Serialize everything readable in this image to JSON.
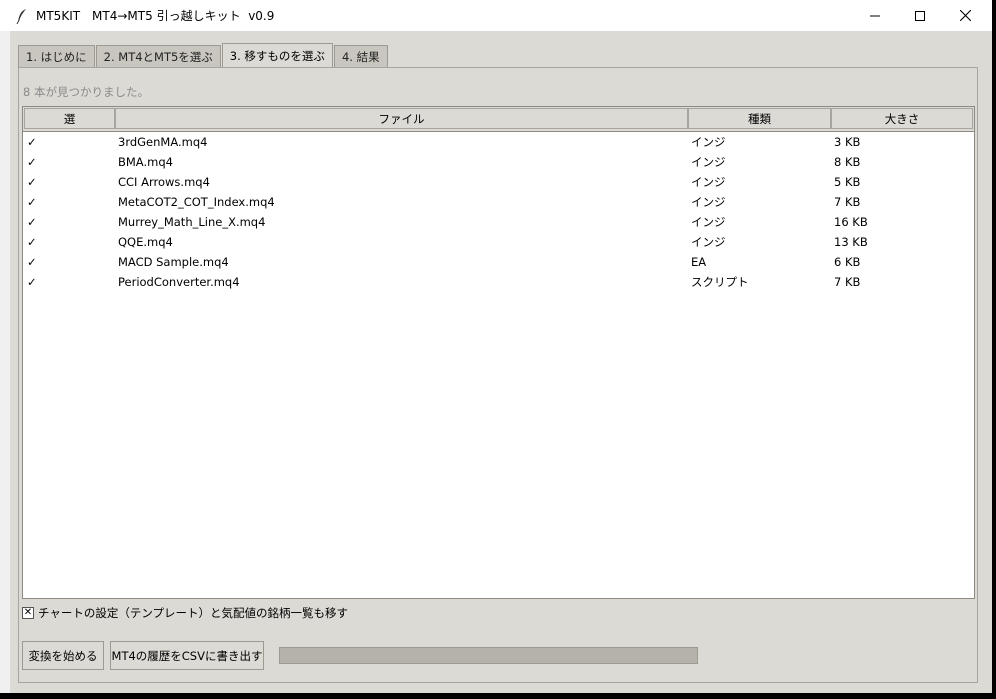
{
  "window": {
    "title": "MT5KIT　MT4→MT5 引っ越しキット  v0.9",
    "icon": "feather-icon"
  },
  "tabs": [
    {
      "label": "1. はじめに",
      "active": false
    },
    {
      "label": "2. MT4とMT5を選ぶ",
      "active": false
    },
    {
      "label": "3. 移すものを選ぶ",
      "active": true
    },
    {
      "label": "4. 結果",
      "active": false
    }
  ],
  "status_text": "8 本が見つかりました。",
  "table": {
    "columns": [
      "選",
      "ファイル",
      "種類",
      "大きさ"
    ],
    "rows": [
      {
        "check": "✓",
        "file": "3rdGenMA.mq4",
        "type": "インジ",
        "size": "3 KB"
      },
      {
        "check": "✓",
        "file": "BMA.mq4",
        "type": "インジ",
        "size": "8 KB"
      },
      {
        "check": "✓",
        "file": "CCI Arrows.mq4",
        "type": "インジ",
        "size": "5 KB"
      },
      {
        "check": "✓",
        "file": "MetaCOT2_COT_Index.mq4",
        "type": "インジ",
        "size": "7 KB"
      },
      {
        "check": "✓",
        "file": "Murrey_Math_Line_X.mq4",
        "type": "インジ",
        "size": "16 KB"
      },
      {
        "check": "✓",
        "file": "QQE.mq4",
        "type": "インジ",
        "size": "13 KB"
      },
      {
        "check": "✓",
        "file": "MACD Sample.mq4",
        "type": "EA",
        "size": "6 KB"
      },
      {
        "check": "✓",
        "file": "PeriodConverter.mq4",
        "type": "スクリプト",
        "size": "7 KB"
      }
    ]
  },
  "options": {
    "move_chart_label": "チャートの設定（テンプレート）と気配値の銘柄一覧も移す",
    "move_chart_checked": true,
    "check_mark": "✕"
  },
  "buttons": {
    "start_label": "変換を始める",
    "export_label": "MT4の履歴をCSVに書き出す"
  },
  "progress": {
    "value": 0
  }
}
